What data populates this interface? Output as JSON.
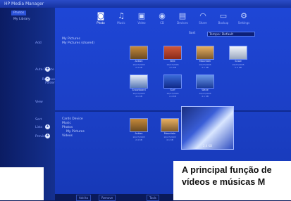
{
  "window": {
    "title": "HP Media Manager"
  },
  "sidebar": {
    "tabs": [
      {
        "label": "Photos",
        "active": true
      },
      {
        "label": "My Library",
        "active": false
      }
    ],
    "rows": [
      {
        "label": "Add",
        "icon": ""
      },
      {
        "label": "Auto Create",
        "icon": "+"
      },
      {
        "label": "Remove Folder",
        "icon": "-"
      },
      {
        "label": "View",
        "icon": ""
      },
      {
        "label": "Sort",
        "icon": ""
      },
      {
        "label": "Lists",
        "icon": "+"
      },
      {
        "label": "Preview",
        "icon": "+"
      }
    ]
  },
  "toolbar": {
    "items": [
      {
        "label": "Photo",
        "icon": "camera-icon",
        "glyph": "◙",
        "active": true
      },
      {
        "label": "Music",
        "icon": "music-icon",
        "glyph": "♫",
        "active": false
      },
      {
        "label": "Video",
        "icon": "film-icon",
        "glyph": "▣",
        "active": false
      },
      {
        "label": "CD",
        "icon": "disc-icon",
        "glyph": "◉",
        "active": false
      },
      {
        "label": "Devices",
        "icon": "device-icon",
        "glyph": "▤",
        "active": false
      },
      {
        "label": "Share",
        "icon": "share-icon",
        "glyph": "◠",
        "active": false
      },
      {
        "label": "Backup",
        "icon": "backup-icon",
        "glyph": "▭",
        "active": false
      },
      {
        "label": "Settings",
        "icon": "gear-icon",
        "glyph": "⚙",
        "active": false
      }
    ]
  },
  "sortbar": {
    "label": "Sort",
    "value": "Tempo: Default"
  },
  "upper_tree": [
    "My Pictures",
    "My Pictures (shared)"
  ],
  "upper_thumbs": [
    {
      "name": "Action",
      "date": "10/27/2005",
      "size": "2.4 KB"
    },
    {
      "name": "Bird",
      "date": "10/27/2005",
      "size": "3.1 KB"
    },
    {
      "name": "Mountain",
      "date": "10/27/2005",
      "size": "4.1 KB"
    },
    {
      "name": "Snow",
      "date": "10/27/2005",
      "size": "2.4 KB"
    },
    {
      "name": "Snowboard",
      "date": "10/27/2005",
      "size": "4.1 KB"
    },
    {
      "name": "Surf",
      "date": "10/27/2005",
      "size": "2.4 KB"
    },
    {
      "name": "Wave",
      "date": "10/27/2005",
      "size": "4.1 KB"
    }
  ],
  "lower_tree": [
    "Cards Device",
    "Music",
    "Photos",
    "My Pictures",
    "Videos"
  ],
  "lower_thumbs": [
    {
      "name": "Action",
      "date": "10/27/2005",
      "size": "2.4 KB"
    },
    {
      "name": "Mountain",
      "date": "10/27/2005",
      "size": "4.1 KB"
    }
  ],
  "popup": {
    "caption": "2.4 KB"
  },
  "bottombar": {
    "buttons": [
      "Add to",
      "Remove",
      "Tools"
    ]
  },
  "caption_lines": [
    "A principal função de",
    "vídeos e músicas M"
  ]
}
